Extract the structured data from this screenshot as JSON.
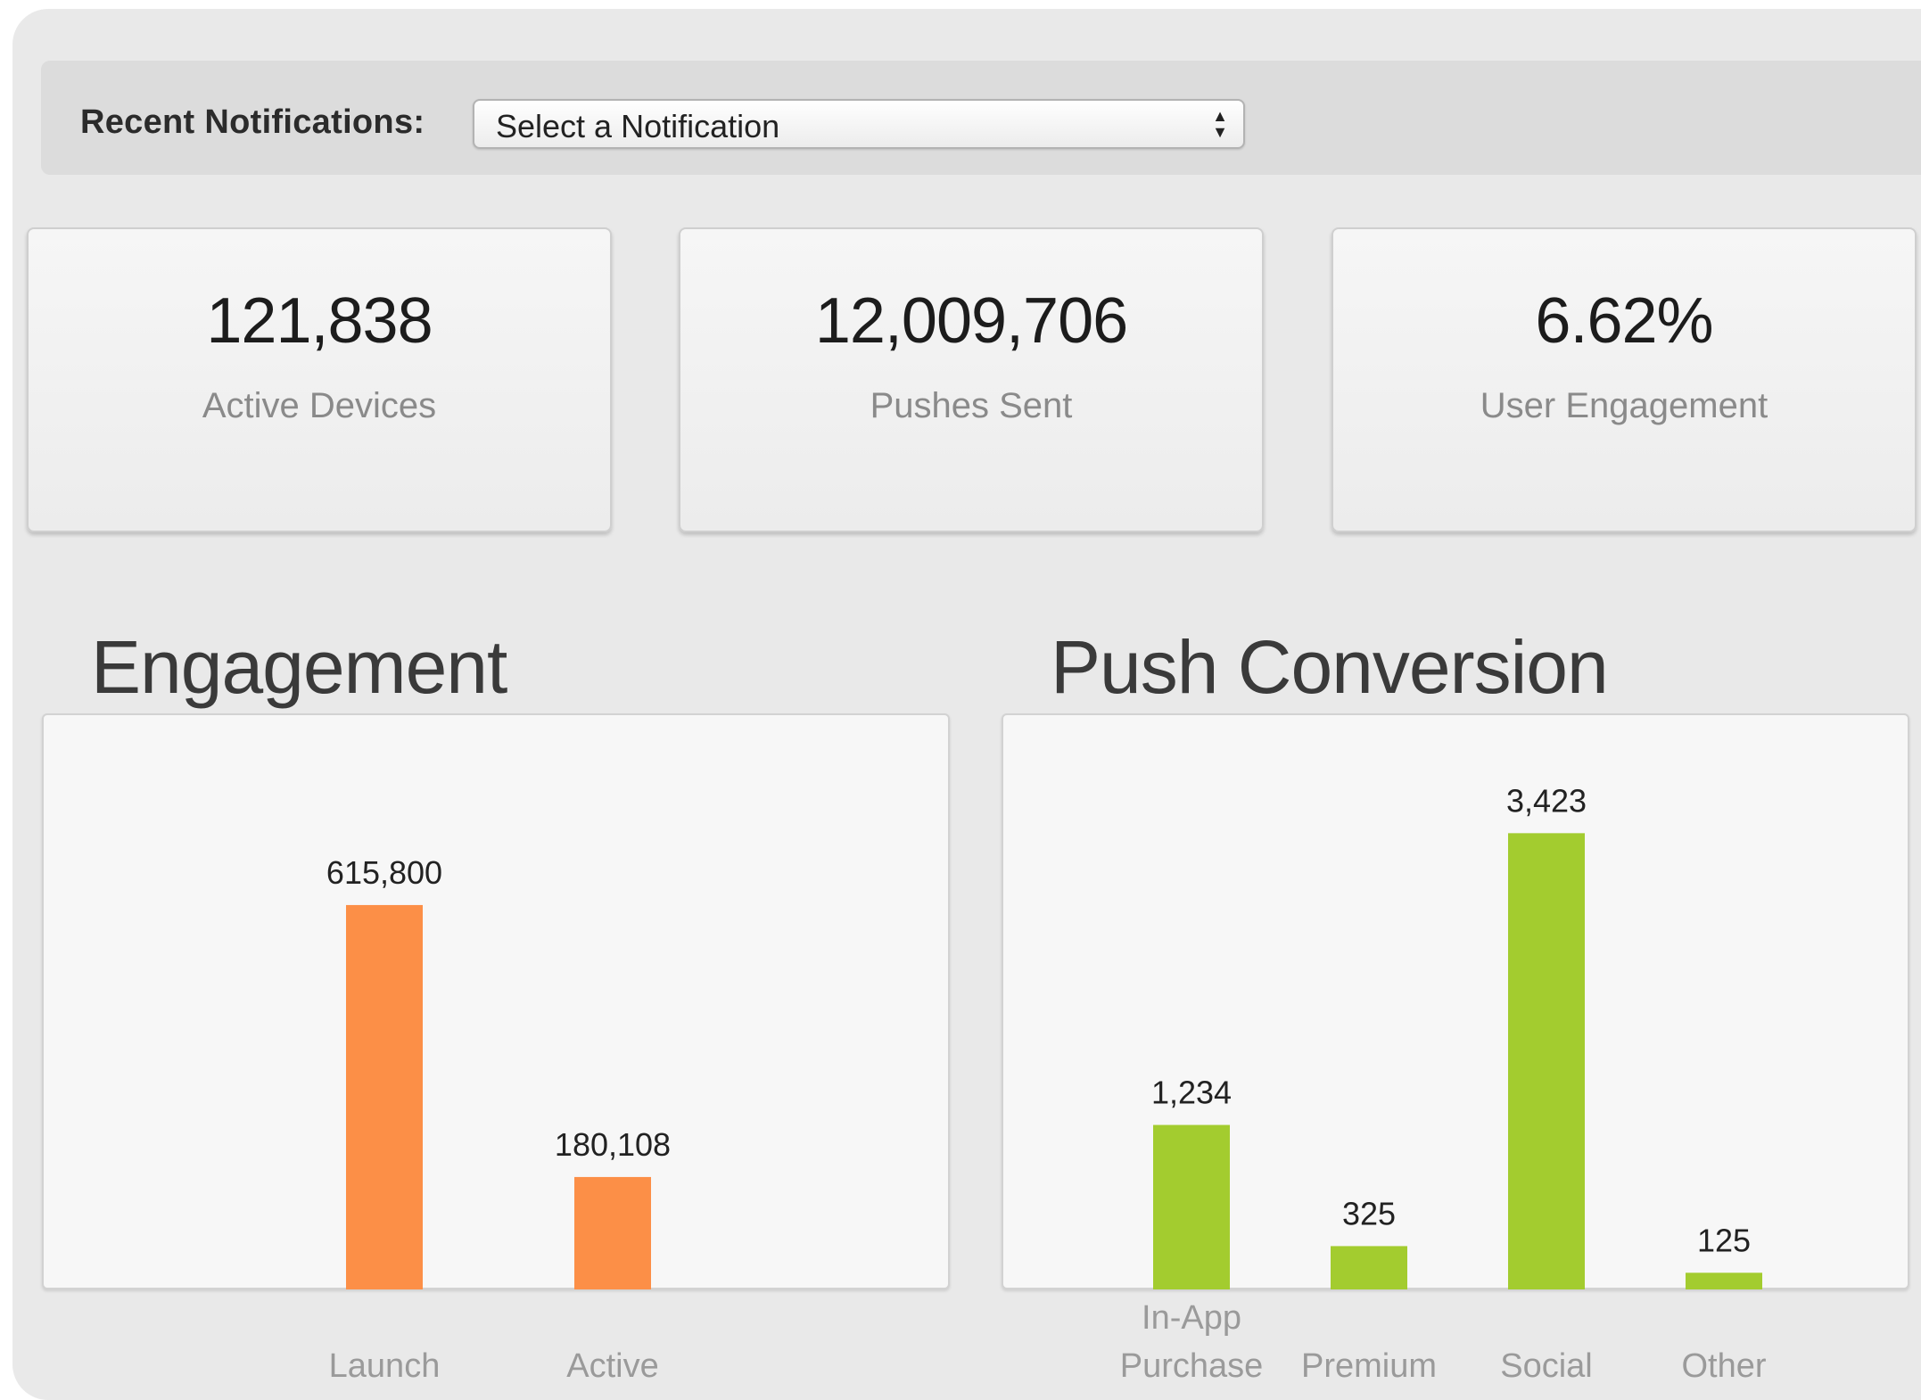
{
  "filter": {
    "label": "Recent Notifications:",
    "select_value": "Select a Notification"
  },
  "stats": [
    {
      "value": "121,838",
      "label": "Active Devices"
    },
    {
      "value": "12,009,706",
      "label": "Pushes Sent"
    },
    {
      "value": "6.62%",
      "label": "User Engagement"
    }
  ],
  "sections": {
    "engagement_title": "Engagement",
    "conversion_title": "Push Conversion"
  },
  "colors": {
    "engagement_bar": "#fc8f47",
    "conversion_bar": "#a3cc2f"
  },
  "chart_data": [
    {
      "type": "bar",
      "title": "Engagement",
      "categories": [
        "Launch",
        "Active"
      ],
      "values": [
        615800,
        180108
      ],
      "data_labels": [
        "615,800",
        "180,108"
      ],
      "ylim": [
        0,
        780000
      ],
      "grid": false,
      "color": "#fc8f47"
    },
    {
      "type": "bar",
      "title": "Push Conversion",
      "categories": [
        "In-App\nPurchase",
        "Premium",
        "Social",
        "Other"
      ],
      "values": [
        1234,
        325,
        3423,
        125
      ],
      "data_labels": [
        "1,234",
        "325",
        "3,423",
        "125"
      ],
      "ylim": [
        0,
        3800
      ],
      "grid": false,
      "color": "#a3cc2f"
    }
  ]
}
